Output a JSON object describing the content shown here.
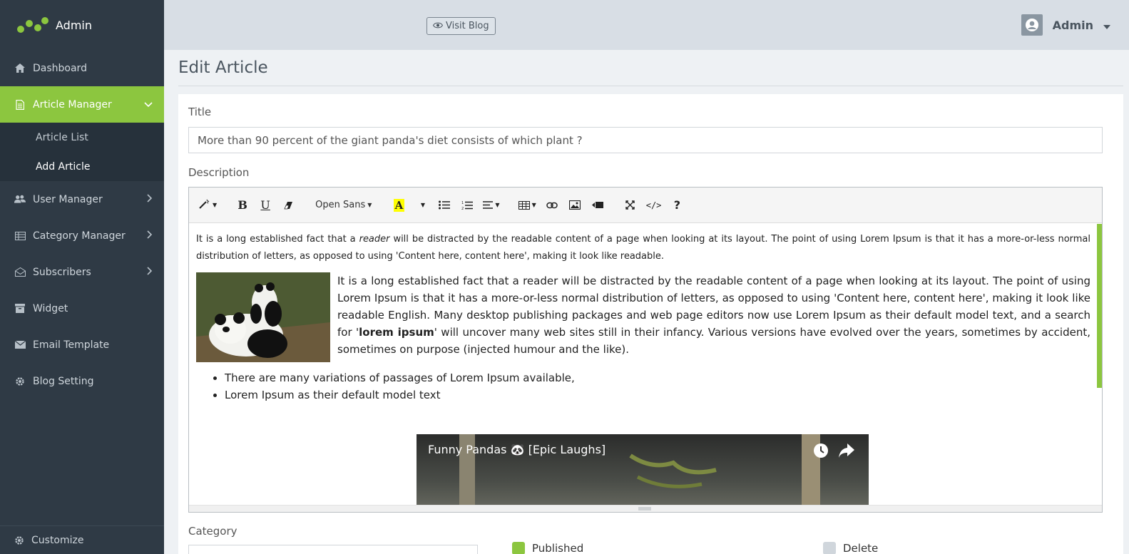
{
  "brand": {
    "name": "Admin"
  },
  "sidebar": {
    "items": [
      {
        "label": "Dashboard"
      },
      {
        "label": "Article Manager"
      },
      {
        "label": "User Manager"
      },
      {
        "label": "Category Manager"
      },
      {
        "label": "Subscribers"
      },
      {
        "label": "Widget"
      },
      {
        "label": "Email Template"
      },
      {
        "label": "Blog Setting"
      }
    ],
    "submenu": [
      {
        "label": "Article List"
      },
      {
        "label": "Add Article"
      }
    ],
    "bottom": {
      "label": "Customize"
    }
  },
  "topbar": {
    "visit_label": "Visit Blog",
    "user_name": "Admin"
  },
  "page": {
    "title": "Edit Article"
  },
  "form": {
    "title_label": "Title",
    "title_value": "More than 90 percent of the giant panda's diet consists of which plant ?",
    "description_label": "Description",
    "category_label": "Category",
    "published_label": "Published",
    "delete_label": "Delete"
  },
  "editor": {
    "font_name": "Open Sans",
    "para1_a": "It is a long established fact that a ",
    "para1_em": "reader",
    "para1_b": " will be distracted by the readable content of a page when looking at its layout. The point of using Lorem Ipsum is that it has a more-or-less normal distribution of letters, as opposed to using 'Content here, content here', making it look like readable.",
    "para2_a": "It is a long established fact that a reader will be distracted by the readable content of a page when looking at its layout. The point of using Lorem Ipsum is that it has a more-or-less normal distribution of letters, as opposed to using 'Content here, content here', making it look like readable English. Many desktop publishing packages and web page editors now use Lorem Ipsum as their default model text, and a search for '",
    "para2_strong": "lorem ipsum",
    "para2_b": "' will uncover many web sites still in their infancy. Various versions have evolved over the years, sometimes by accident, sometimes on purpose (injected humour and the like).",
    "bullets": [
      "There are many variations of passages of Lorem Ipsum available,",
      "Lorem Ipsum as their default model text"
    ],
    "video_title": "Funny Pandas 🐼 [Epic Laughs]"
  },
  "colors": {
    "accent": "#8cc63f",
    "sidebar": "#2f3a45",
    "topbar": "#d8dee5"
  }
}
